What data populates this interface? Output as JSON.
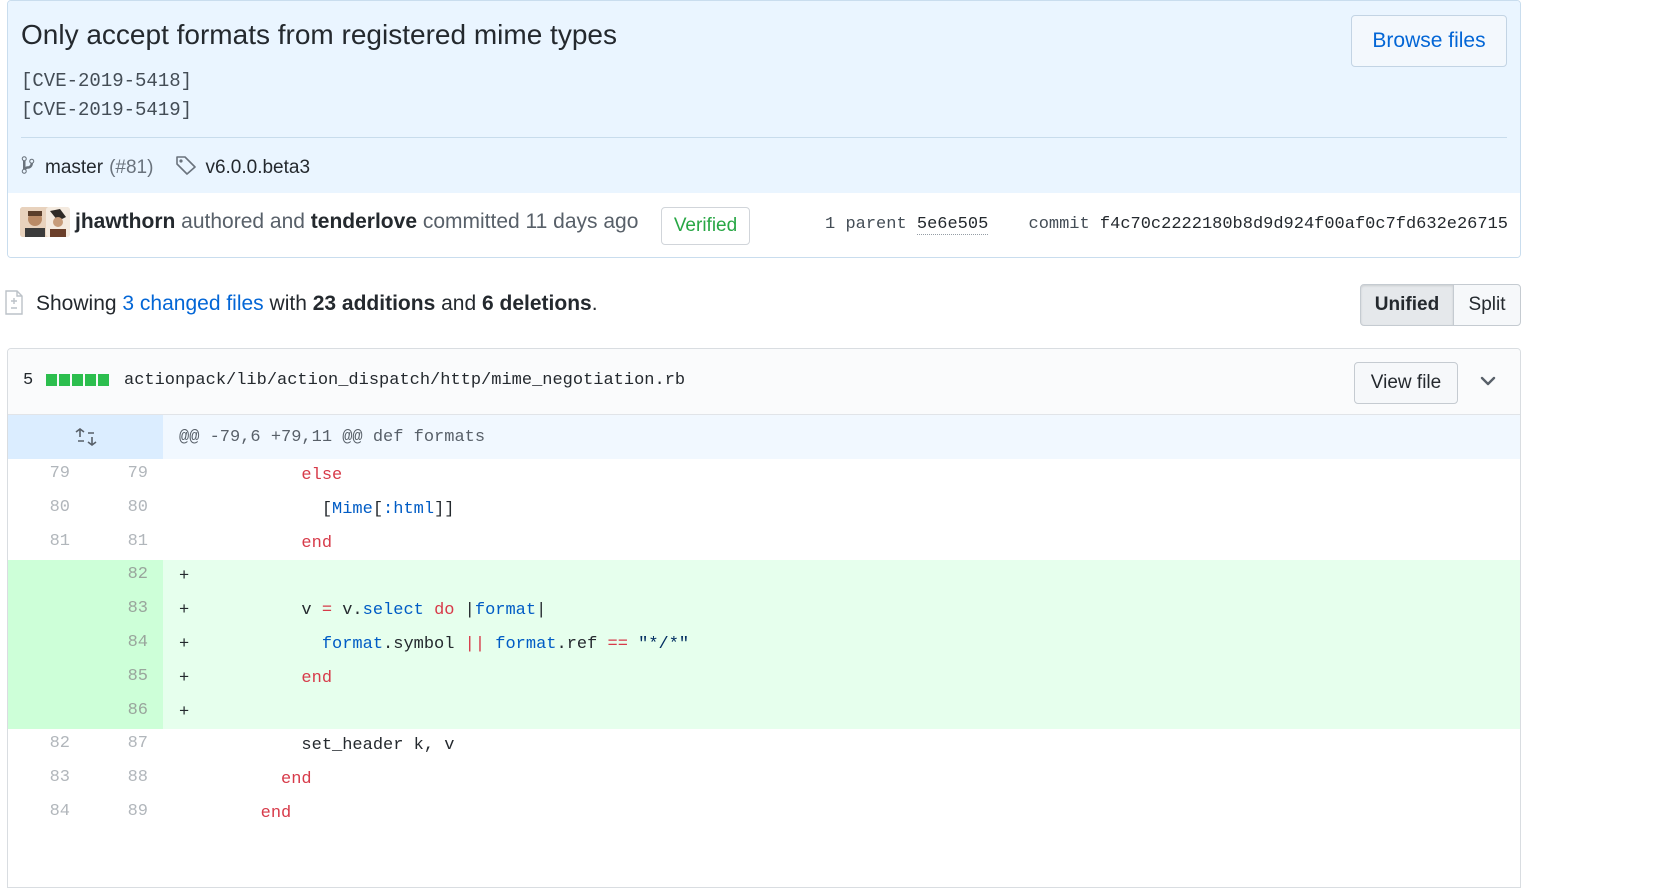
{
  "commit": {
    "title": "Only accept formats from registered mime types",
    "description": "[CVE-2019-5418]\n[CVE-2019-5419]",
    "browse_files_label": "Browse files",
    "branch": "master",
    "pr_ref": "(#81)",
    "tag": "v6.0.0.beta3",
    "author": "jhawthorn",
    "authored_text": "authored and",
    "committer": "tenderlove",
    "committed_text": "committed",
    "time_ago": "11 days ago",
    "verified_label": "Verified",
    "parent_label": "1 parent",
    "parent_sha": "5e6e505",
    "commit_label": "commit",
    "commit_sha": "f4c70c2222180b8d9d924f00af0c7fd632e26715"
  },
  "toc": {
    "showing": "Showing",
    "changed_files": "3 changed files",
    "with": "with",
    "additions": "23 additions",
    "and": "and",
    "deletions": "6 deletions",
    "period": ".",
    "unified_label": "Unified",
    "split_label": "Split"
  },
  "file": {
    "diffstat_count": "5",
    "path": "actionpack/lib/action_dispatch/http/mime_negotiation.rb",
    "view_file_label": "View file",
    "hunk_header": "@@ -79,6 +79,11 @@ def formats",
    "lines": [
      {
        "old": "79",
        "new": "79",
        "type": "ctx",
        "code": [
          {
            "t": "            "
          },
          {
            "t": "else",
            "c": "kw"
          }
        ]
      },
      {
        "old": "80",
        "new": "80",
        "type": "ctx",
        "code": [
          {
            "t": "              ["
          },
          {
            "t": "Mime",
            "c": "cn"
          },
          {
            "t": "["
          },
          {
            "t": ":html",
            "c": "cn"
          },
          {
            "t": "]]"
          }
        ]
      },
      {
        "old": "81",
        "new": "81",
        "type": "ctx",
        "code": [
          {
            "t": "            "
          },
          {
            "t": "end",
            "c": "kw"
          }
        ]
      },
      {
        "old": "",
        "new": "82",
        "type": "add",
        "code": [
          {
            "t": "+"
          }
        ]
      },
      {
        "old": "",
        "new": "83",
        "type": "add",
        "code": [
          {
            "t": "+           v "
          },
          {
            "t": "=",
            "c": "kw"
          },
          {
            "t": " v."
          },
          {
            "t": "select",
            "c": "cn"
          },
          {
            "t": " "
          },
          {
            "t": "do",
            "c": "kw"
          },
          {
            "t": " |"
          },
          {
            "t": "format",
            "c": "cn"
          },
          {
            "t": "|"
          }
        ]
      },
      {
        "old": "",
        "new": "84",
        "type": "add",
        "code": [
          {
            "t": "+             "
          },
          {
            "t": "format",
            "c": "cn"
          },
          {
            "t": ".symbol "
          },
          {
            "t": "||",
            "c": "kw"
          },
          {
            "t": " "
          },
          {
            "t": "format",
            "c": "cn"
          },
          {
            "t": ".ref "
          },
          {
            "t": "==",
            "c": "kw"
          },
          {
            "t": " "
          },
          {
            "t": "\"*/*\"",
            "c": "st"
          }
        ]
      },
      {
        "old": "",
        "new": "85",
        "type": "add",
        "code": [
          {
            "t": "+           "
          },
          {
            "t": "end",
            "c": "kw"
          }
        ]
      },
      {
        "old": "",
        "new": "86",
        "type": "add",
        "code": [
          {
            "t": "+"
          }
        ]
      },
      {
        "old": "82",
        "new": "87",
        "type": "ctx",
        "code": [
          {
            "t": "            set_header k, v"
          }
        ]
      },
      {
        "old": "83",
        "new": "88",
        "type": "ctx",
        "code": [
          {
            "t": "          "
          },
          {
            "t": "end",
            "c": "kw"
          }
        ]
      },
      {
        "old": "84",
        "new": "89",
        "type": "ctx",
        "code": [
          {
            "t": "        "
          },
          {
            "t": "end",
            "c": "kw"
          }
        ]
      }
    ]
  },
  "colors": {
    "link": "#0366d6",
    "verified": "#28a745",
    "addition_bg": "#e6ffed",
    "addition_gutter": "#cdffd8",
    "hunk_bg": "#f1f8ff"
  }
}
